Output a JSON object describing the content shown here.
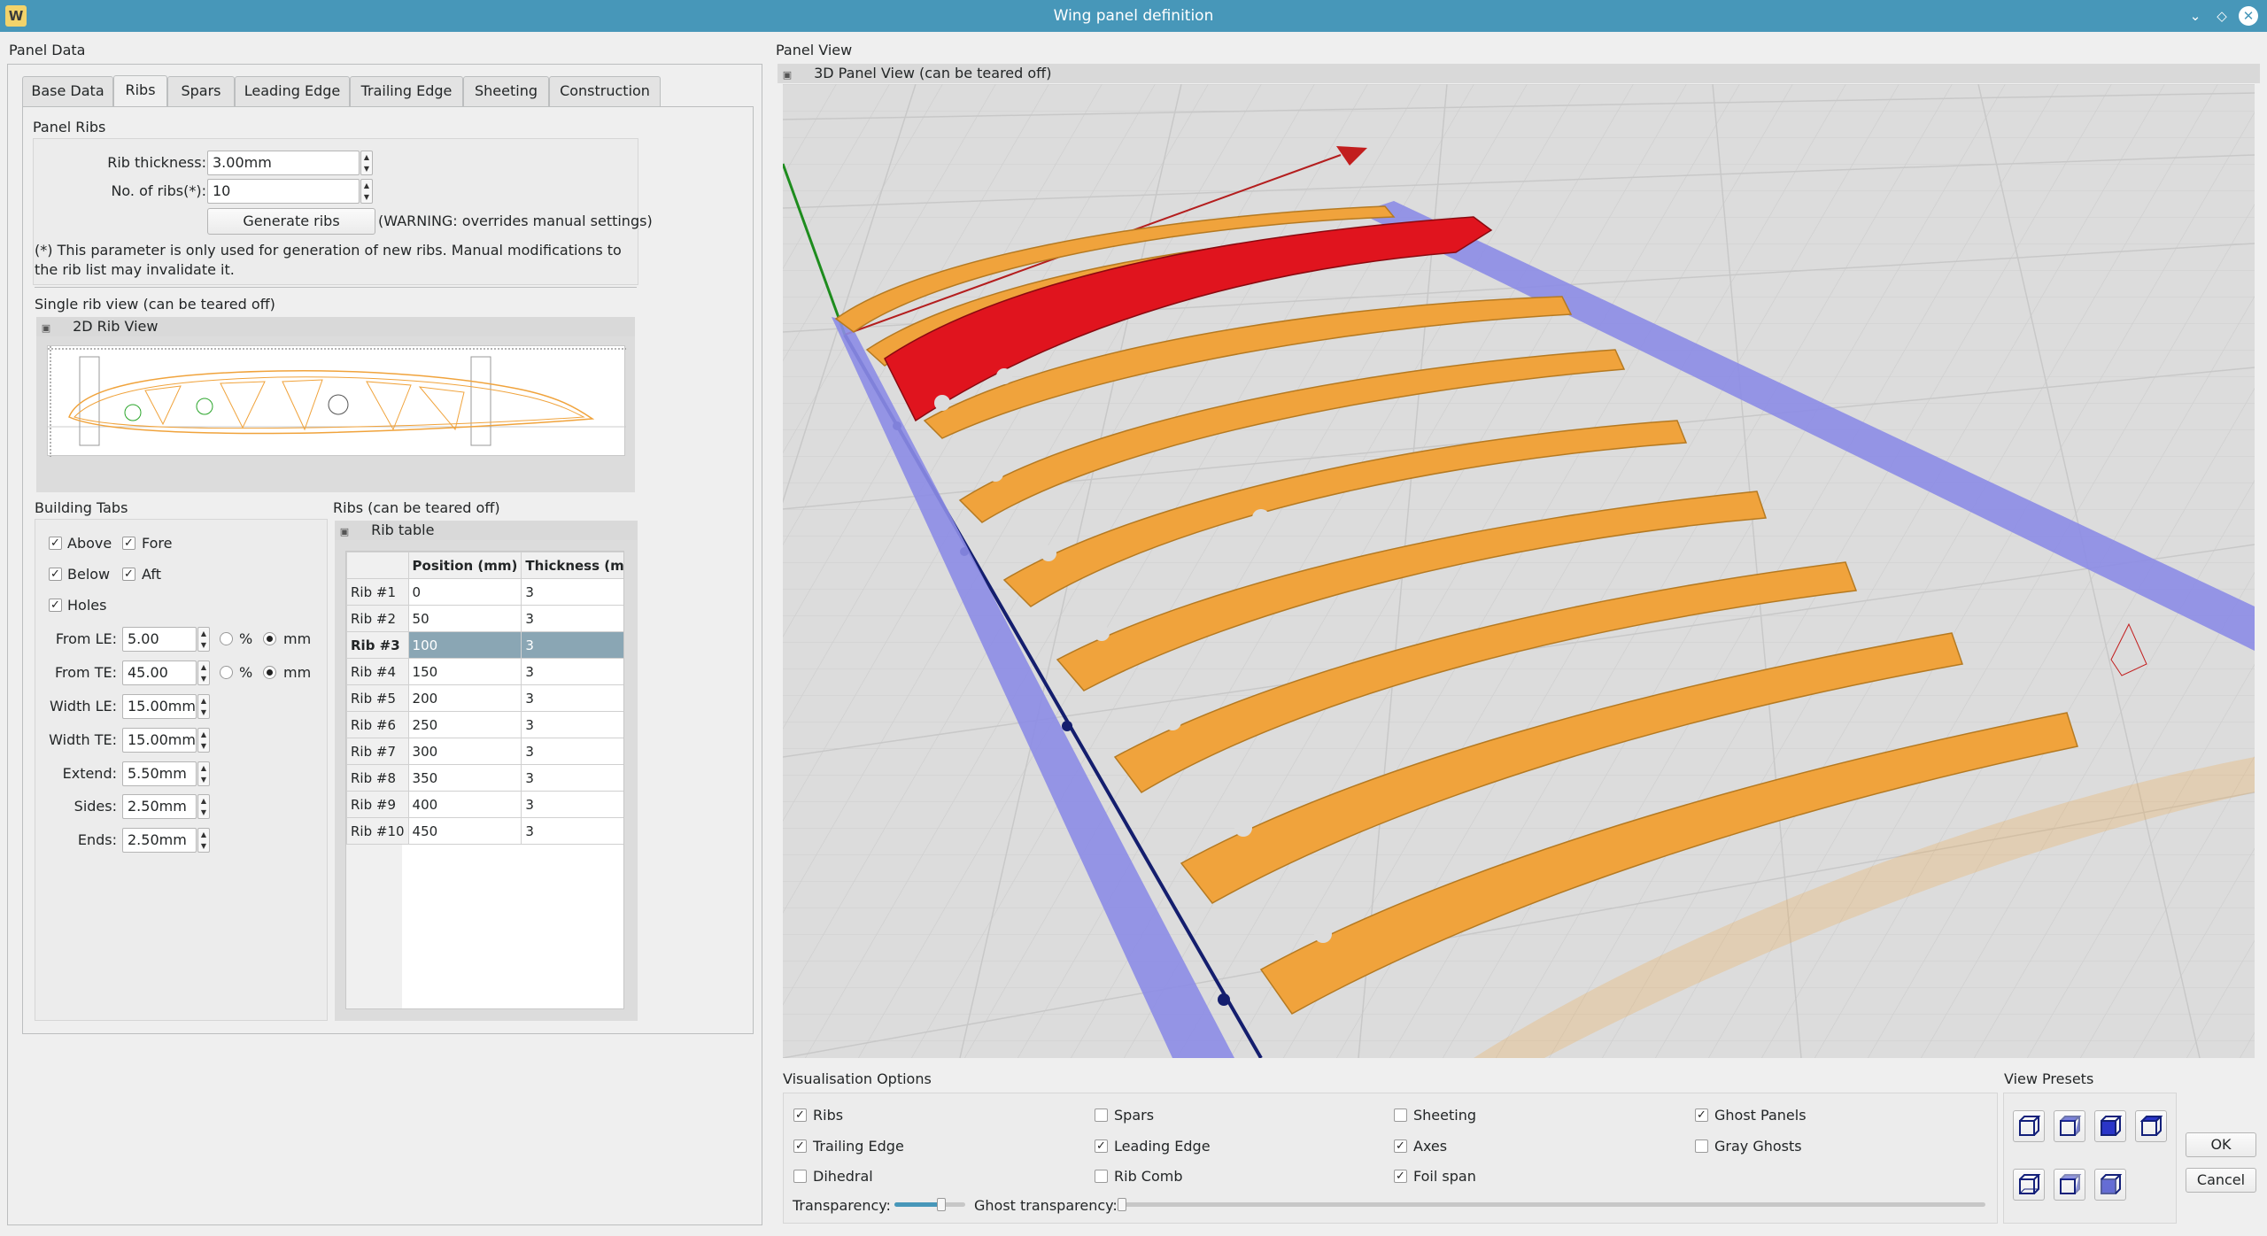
{
  "window": {
    "title": "Wing panel definition"
  },
  "left_panel": {
    "title": "Panel Data",
    "tabs": [
      "Base Data",
      "Ribs",
      "Spars",
      "Leading Edge",
      "Trailing Edge",
      "Sheeting",
      "Construction"
    ],
    "active_tab": "Ribs",
    "panel_ribs": {
      "title": "Panel Ribs",
      "rib_thickness_label": "Rib thickness:",
      "rib_thickness_value": "3.00mm",
      "num_ribs_label": "No. of ribs(*):",
      "num_ribs_value": "10",
      "generate_button": "Generate ribs",
      "warning": "(WARNING: overrides manual settings)",
      "note": "(*) This parameter is only used for generation of new ribs. Manual modifications to the rib list may invalidate it."
    },
    "single_rib_view": {
      "title": "Single rib view (can be teared off)",
      "dock_title": "2D Rib View"
    },
    "building_tabs": {
      "title": "Building Tabs",
      "above": {
        "label": "Above",
        "checked": true
      },
      "fore": {
        "label": "Fore",
        "checked": true
      },
      "below": {
        "label": "Below",
        "checked": true
      },
      "aft": {
        "label": "Aft",
        "checked": true
      },
      "holes": {
        "label": "Holes",
        "checked": true
      },
      "from_le": {
        "label": "From LE:",
        "value": "5.00"
      },
      "from_te": {
        "label": "From TE:",
        "value": "45.00"
      },
      "unit_percent": "%",
      "unit_mm": "mm",
      "width_le": {
        "label": "Width LE:",
        "value": "15.00mm"
      },
      "width_te": {
        "label": "Width TE:",
        "value": "15.00mm"
      },
      "extend": {
        "label": "Extend:",
        "value": "5.50mm"
      },
      "sides": {
        "label": "Sides:",
        "value": "2.50mm"
      },
      "ends": {
        "label": "Ends:",
        "value": "2.50mm"
      }
    },
    "ribs_table": {
      "title": "Ribs (can be teared off)",
      "dock_title": "Rib table",
      "columns": [
        "Position (mm)",
        "Thickness (mm)"
      ],
      "rows": [
        {
          "name": "Rib #1",
          "position": "0",
          "thickness": "3"
        },
        {
          "name": "Rib #2",
          "position": "50",
          "thickness": "3"
        },
        {
          "name": "Rib #3",
          "position": "100",
          "thickness": "3"
        },
        {
          "name": "Rib #4",
          "position": "150",
          "thickness": "3"
        },
        {
          "name": "Rib #5",
          "position": "200",
          "thickness": "3"
        },
        {
          "name": "Rib #6",
          "position": "250",
          "thickness": "3"
        },
        {
          "name": "Rib #7",
          "position": "300",
          "thickness": "3"
        },
        {
          "name": "Rib #8",
          "position": "350",
          "thickness": "3"
        },
        {
          "name": "Rib #9",
          "position": "400",
          "thickness": "3"
        },
        {
          "name": "Rib #10",
          "position": "450",
          "thickness": "3"
        }
      ],
      "selected_row": "Rib #3"
    }
  },
  "right_panel": {
    "title": "Panel View",
    "dock_title": "3D Panel View (can be teared off)",
    "vis_options": {
      "title": "Visualisation Options",
      "ribs": {
        "label": "Ribs",
        "checked": true
      },
      "spars": {
        "label": "Spars",
        "checked": false
      },
      "sheeting": {
        "label": "Sheeting",
        "checked": false
      },
      "ghost_panels": {
        "label": "Ghost Panels",
        "checked": true
      },
      "trailing_edge": {
        "label": "Trailing Edge",
        "checked": true
      },
      "leading_edge": {
        "label": "Leading Edge",
        "checked": true
      },
      "axes": {
        "label": "Axes",
        "checked": true
      },
      "gray_ghosts": {
        "label": "Gray Ghosts",
        "checked": false
      },
      "dihedral": {
        "label": "Dihedral",
        "checked": false
      },
      "rib_comb": {
        "label": "Rib Comb",
        "checked": false
      },
      "foil_span": {
        "label": "Foil span",
        "checked": true
      },
      "transparency_label": "Transparency:",
      "ghost_transparency_label": "Ghost transparency:",
      "transparency_level": 0.65,
      "ghost_transparency_level": 0.0
    },
    "view_presets": {
      "title": "View Presets"
    }
  },
  "buttons": {
    "ok": "OK",
    "cancel": "Cancel"
  },
  "colors": {
    "rib": "#f0a33c",
    "rib_selected": "#e0141e",
    "edge_bar": "#8c8ce6",
    "axis_x": "#b41e1e",
    "axis_y": "#1e8c1e",
    "axis_z": "#141e6e",
    "titlebar": "#4797b9"
  }
}
